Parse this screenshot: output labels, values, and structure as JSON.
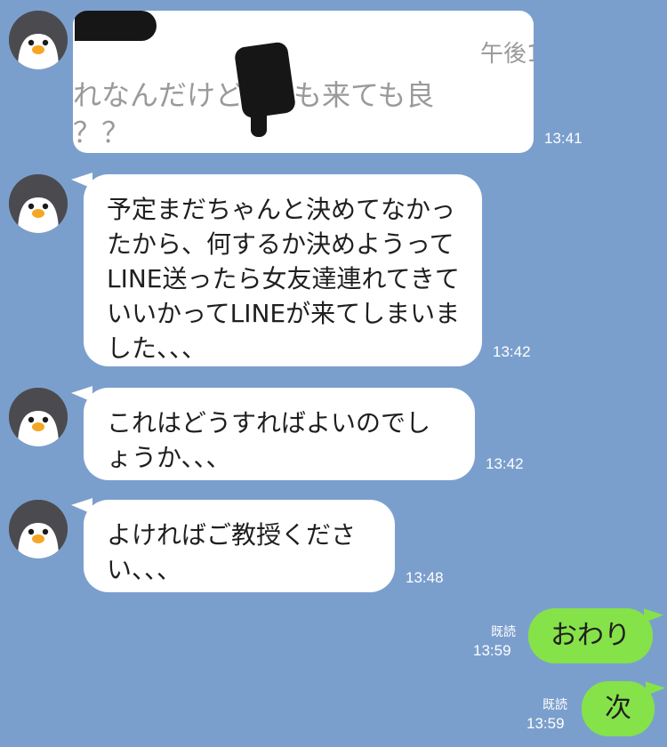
{
  "quoted_image": {
    "time": "午後1",
    "line1": "れなんだけど、",
    "line1_suffix": "も来ても良",
    "line2": "？？",
    "timestamp": "13:41"
  },
  "messages": [
    {
      "text": "予定まだちゃんと決めてなかったから、何するか決めようってLINE送ったら女友達連れてきていいかってLINEが来てしまいました、、、",
      "time": "13:42"
    },
    {
      "text": "これはどうすればよいのでしょうか、、、",
      "time": "13:42"
    },
    {
      "text": "よければご教授ください、、、",
      "time": "13:48"
    }
  ],
  "outgoing": [
    {
      "read": "既読",
      "text": "おわり",
      "time": "13:59"
    },
    {
      "read": "既読",
      "text": "次",
      "time": "13:59"
    }
  ],
  "colors": {
    "background": "#7b9fcd",
    "incoming_bubble": "#ffffff",
    "outgoing_bubble": "#85e249"
  },
  "icons": {
    "avatar": "penguin-avatar-icon"
  }
}
